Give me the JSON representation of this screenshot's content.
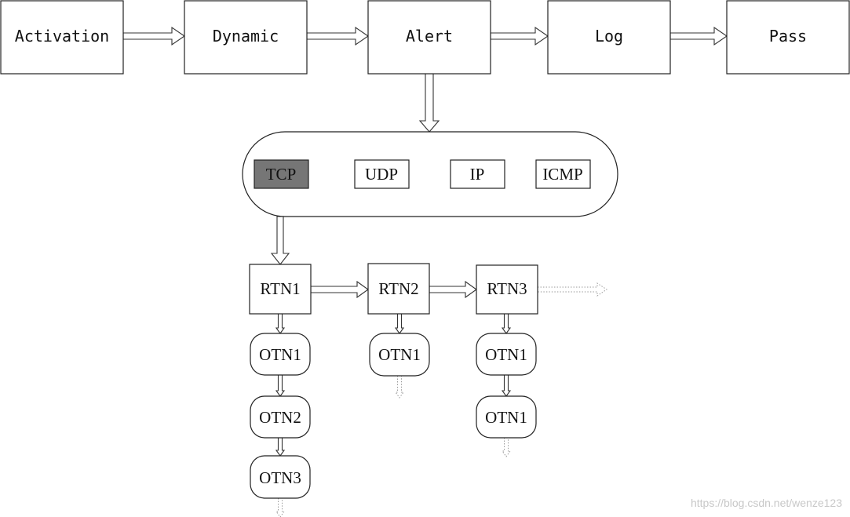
{
  "pipeline": [
    "Activation",
    "Dynamic",
    "Alert",
    "Log",
    "Pass"
  ],
  "protocols": [
    "TCP",
    "UDP",
    "IP",
    "ICMP"
  ],
  "highlight_color": "#767676",
  "rtn_chain": [
    {
      "label": "RTN1",
      "otns": [
        "OTN1",
        "OTN2",
        "OTN3"
      ]
    },
    {
      "label": "RTN2",
      "otns": [
        "OTN1"
      ]
    },
    {
      "label": "RTN3",
      "otns": [
        "OTN1",
        "OTN1"
      ]
    }
  ],
  "watermark": "https://blog.csdn.net/wenze123"
}
